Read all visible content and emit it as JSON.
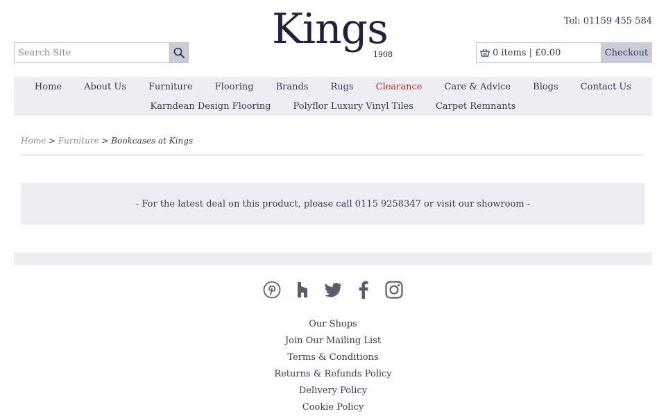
{
  "header": {
    "search_placeholder": "Search Site",
    "logo_text": "Kings",
    "logo_year": "1908",
    "tel_label": "Tel:",
    "tel_number": "01159 455 584",
    "cart_summary": "0 items | £0.00",
    "checkout_label": "Checkout"
  },
  "nav": {
    "row1": [
      "Home",
      "About Us",
      "Furniture",
      "Flooring",
      "Brands",
      "Rugs",
      "Clearance",
      "Care & Advice",
      "Blogs",
      "Contact Us"
    ],
    "row2": [
      "Karndean Design Flooring",
      "Polyflor Luxury Vinyl Tiles",
      "Carpet Remnants"
    ]
  },
  "breadcrumb": {
    "home": "Home",
    "sep1": " > ",
    "furniture": "Furniture",
    "sep2": " > ",
    "current": "Bookcases at Kings"
  },
  "deal_text": "- For the latest deal on this product, please call 0115 9258347 or visit our showroom -",
  "social_icons": [
    "pinterest-icon",
    "houzz-icon",
    "twitter-icon",
    "facebook-icon",
    "instagram-icon"
  ],
  "footer_links": [
    "Our Shops",
    "Join Our Mailing List",
    "Terms & Conditions",
    "Returns & Refunds Policy",
    "Delivery Policy",
    "Cookie Policy"
  ],
  "colors": {
    "brand_navy": "#1d2240",
    "text": "#333a5c",
    "clearance_red": "#c0262d",
    "panel_grey": "#eceef2",
    "button_grey": "#c9ccd9"
  }
}
